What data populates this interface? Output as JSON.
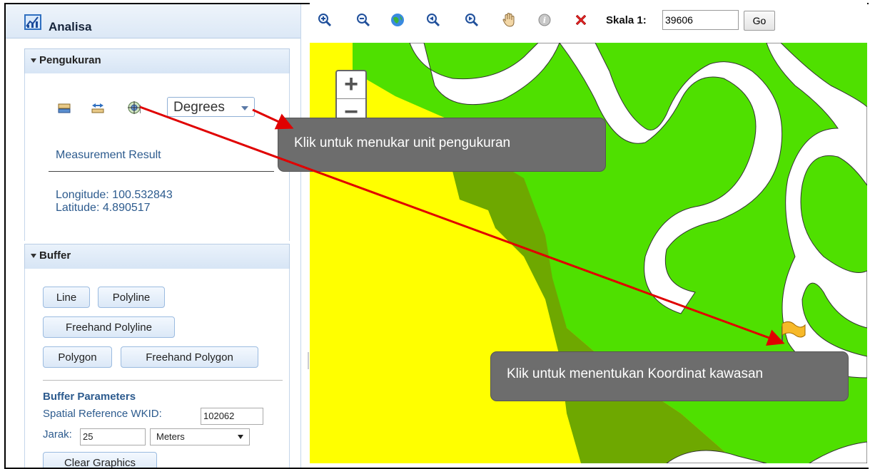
{
  "panel": {
    "title": "Analisa",
    "measurement": {
      "header": "Pengukuran",
      "unit_value": "Degrees",
      "result_title": "Measurement Result",
      "longitude": "Longitude: 100.532843",
      "latitude": "Latitude: 4.890517"
    },
    "buffer": {
      "header": "Buffer",
      "buttons": [
        "Line",
        "Polyline",
        "Freehand Polyline",
        "Polygon",
        "Freehand Polygon"
      ],
      "params_title": "Buffer Parameters",
      "wkid_label": "Spatial Reference WKID:",
      "wkid_value": "102062",
      "distance_label": "Jarak:",
      "distance_value": "25",
      "distance_unit": "Meters",
      "clear_label": "Clear Graphics"
    }
  },
  "toolbar": {
    "icons": [
      "zoom-in-icon",
      "zoom-out-icon",
      "globe-icon",
      "previous-extent-icon",
      "next-extent-icon",
      "pan-hand-icon",
      "info-icon",
      "clear-x-icon"
    ],
    "scale_label": "Skala 1:",
    "scale_value": "39606",
    "go_label": "Go"
  },
  "map": {
    "zoom_in": "+",
    "zoom_out": "−"
  },
  "callouts": {
    "unit": "Klik untuk menukar unit pengukuran",
    "coord": "Klik untuk menentukan Koordinat kawasan"
  },
  "colors": {
    "yellow_zone": "#ffff00",
    "green_zone": "#4fe000",
    "olive_zone": "#6ea800",
    "arrow": "#e00000",
    "callout_bg": "#6d6d6d"
  }
}
